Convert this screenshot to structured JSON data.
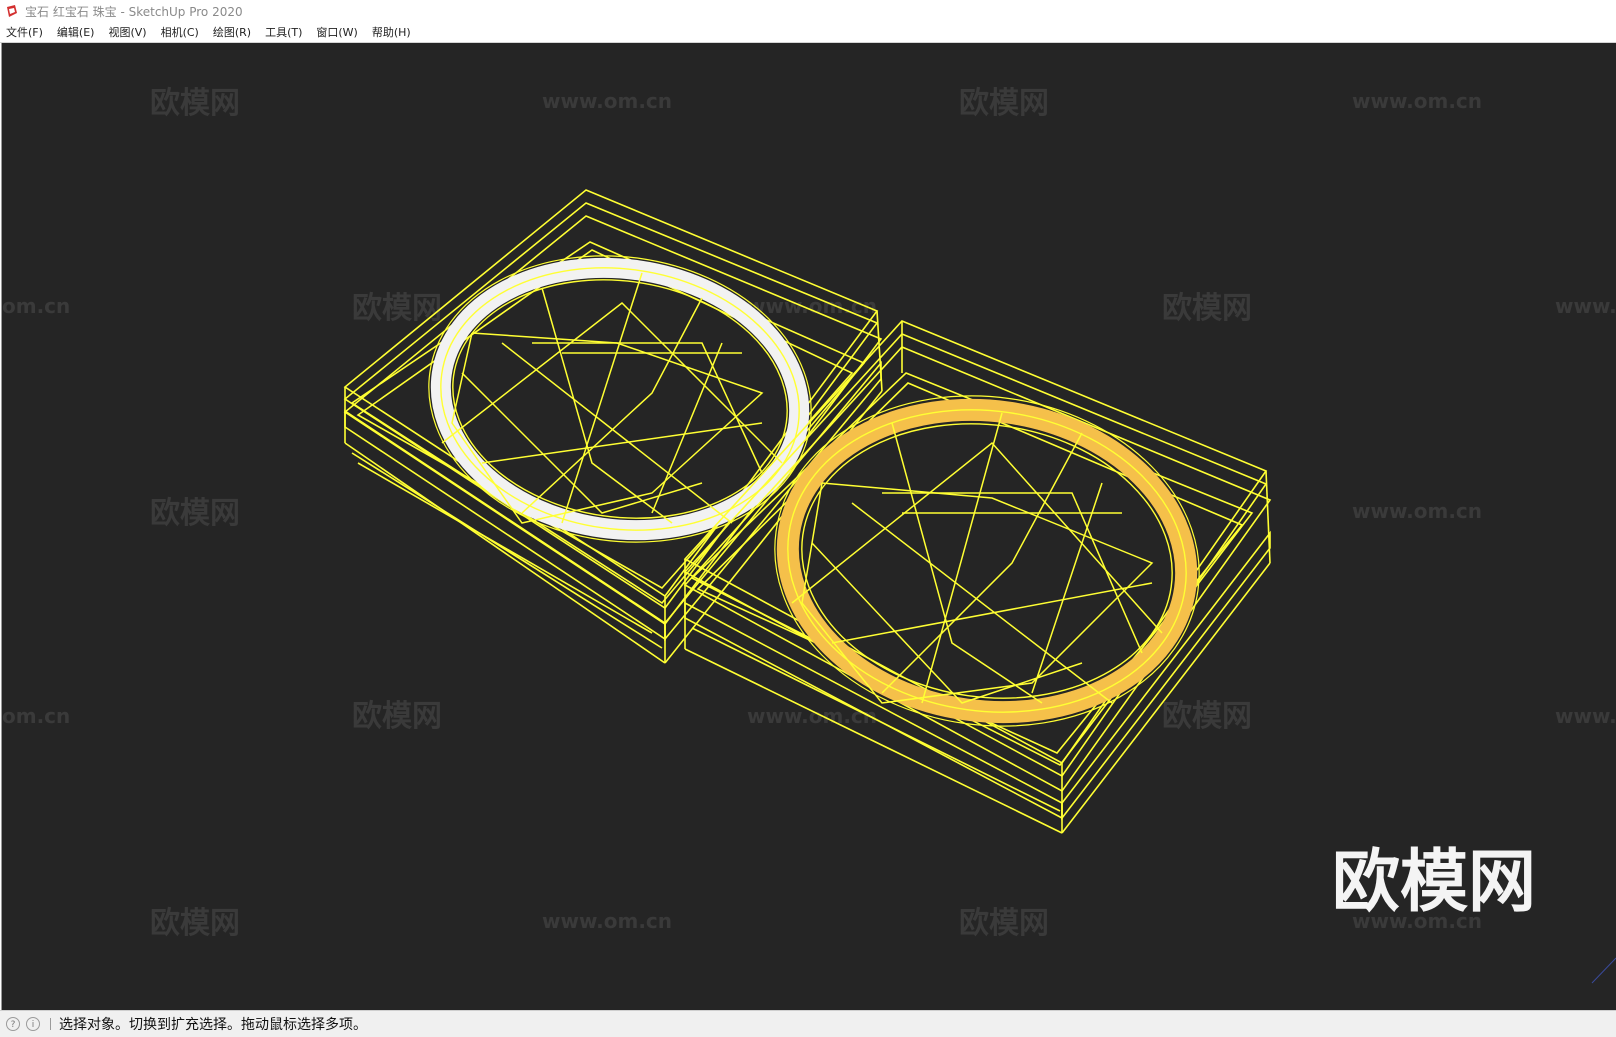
{
  "window": {
    "title": "宝石 红宝石 珠宝 - SketchUp Pro 2020",
    "logo_icon": "sketchup-logo-icon"
  },
  "menu": {
    "items": [
      {
        "label": "文件(F)"
      },
      {
        "label": "编辑(E)"
      },
      {
        "label": "视图(V)"
      },
      {
        "label": "相机(C)"
      },
      {
        "label": "绘图(R)"
      },
      {
        "label": "工具(T)"
      },
      {
        "label": "窗口(W)"
      },
      {
        "label": "帮助(H)"
      }
    ]
  },
  "viewport": {
    "background": "#252525",
    "wire_color": "#ffff33",
    "left_gem_ring_color": "#f2f2f2",
    "right_gem_ring_color": "#f5c04a",
    "watermark_brand": "欧模网",
    "watermark_url": "www.om.cn",
    "watermark_partial_url": "om.cn",
    "watermark_partial_www": "www."
  },
  "status": {
    "icons": [
      "geo-location-icon",
      "info-icon"
    ],
    "message": "选择对象。切换到扩充选择。拖动鼠标选择多项。"
  }
}
